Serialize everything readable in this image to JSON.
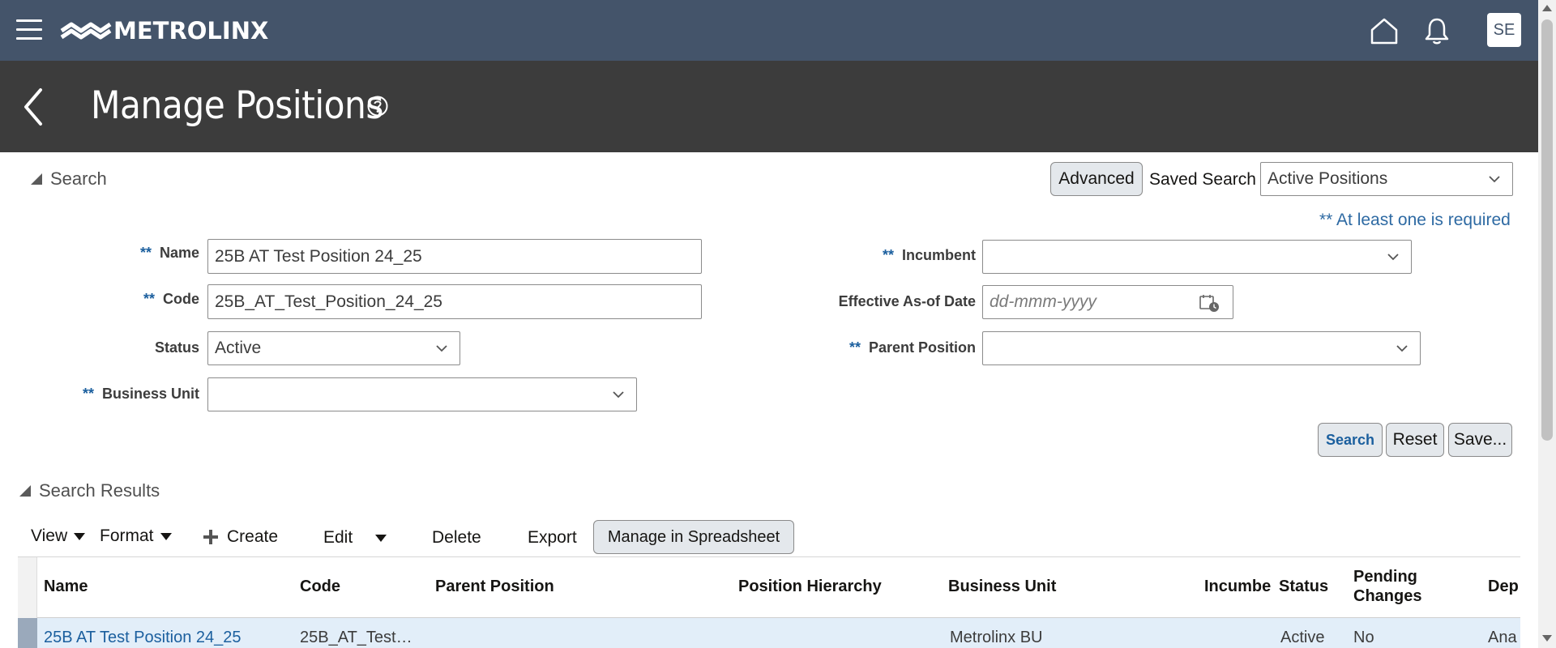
{
  "topbar": {
    "logo_text": "METROLINX",
    "avatar_initials": "SE"
  },
  "header": {
    "title": "Manage Positions"
  },
  "search": {
    "section_label": "Search",
    "advanced_label": "Advanced",
    "saved_search_label": "Saved Search",
    "saved_search_value": "Active Positions",
    "required_note": "** At least one is required",
    "required_marker": "**",
    "fields": {
      "name": {
        "label": "Name",
        "value": "25B AT Test Position 24_25"
      },
      "code": {
        "label": "Code",
        "value": "25B_AT_Test_Position_24_25"
      },
      "status": {
        "label": "Status",
        "value": "Active"
      },
      "business_unit": {
        "label": "Business Unit",
        "value": ""
      },
      "incumbent": {
        "label": "Incumbent",
        "value": ""
      },
      "effective_date": {
        "label": "Effective As-of Date",
        "placeholder": "dd-mmm-yyyy"
      },
      "parent_position": {
        "label": "Parent Position",
        "value": ""
      }
    },
    "buttons": {
      "search": "Search",
      "reset": "Reset",
      "save": "Save..."
    }
  },
  "results": {
    "section_label": "Search Results",
    "toolbar": {
      "view": "View",
      "format": "Format",
      "create": "Create",
      "edit": "Edit",
      "delete": "Delete",
      "export": "Export",
      "manage_spreadsheet": "Manage in Spreadsheet"
    },
    "columns": {
      "name": "Name",
      "code": "Code",
      "parent_position": "Parent Position",
      "position_hierarchy": "Position Hierarchy",
      "business_unit": "Business Unit",
      "incumbent": "Incumbe",
      "status": "Status",
      "pending_line1": "Pending",
      "pending_line2": "Changes",
      "department": "Dep"
    },
    "rows": [
      {
        "name": "25B AT Test Position 24_25",
        "code": "25B_AT_Test…",
        "business_unit": "Metrolinx BU",
        "status": "Active",
        "pending_changes": "No",
        "department": "Ana"
      }
    ]
  },
  "colors": {
    "topbar": "#44546a",
    "header": "#3c3c3c",
    "link": "#1b5f9e",
    "row_selected": "#e2eef9"
  }
}
